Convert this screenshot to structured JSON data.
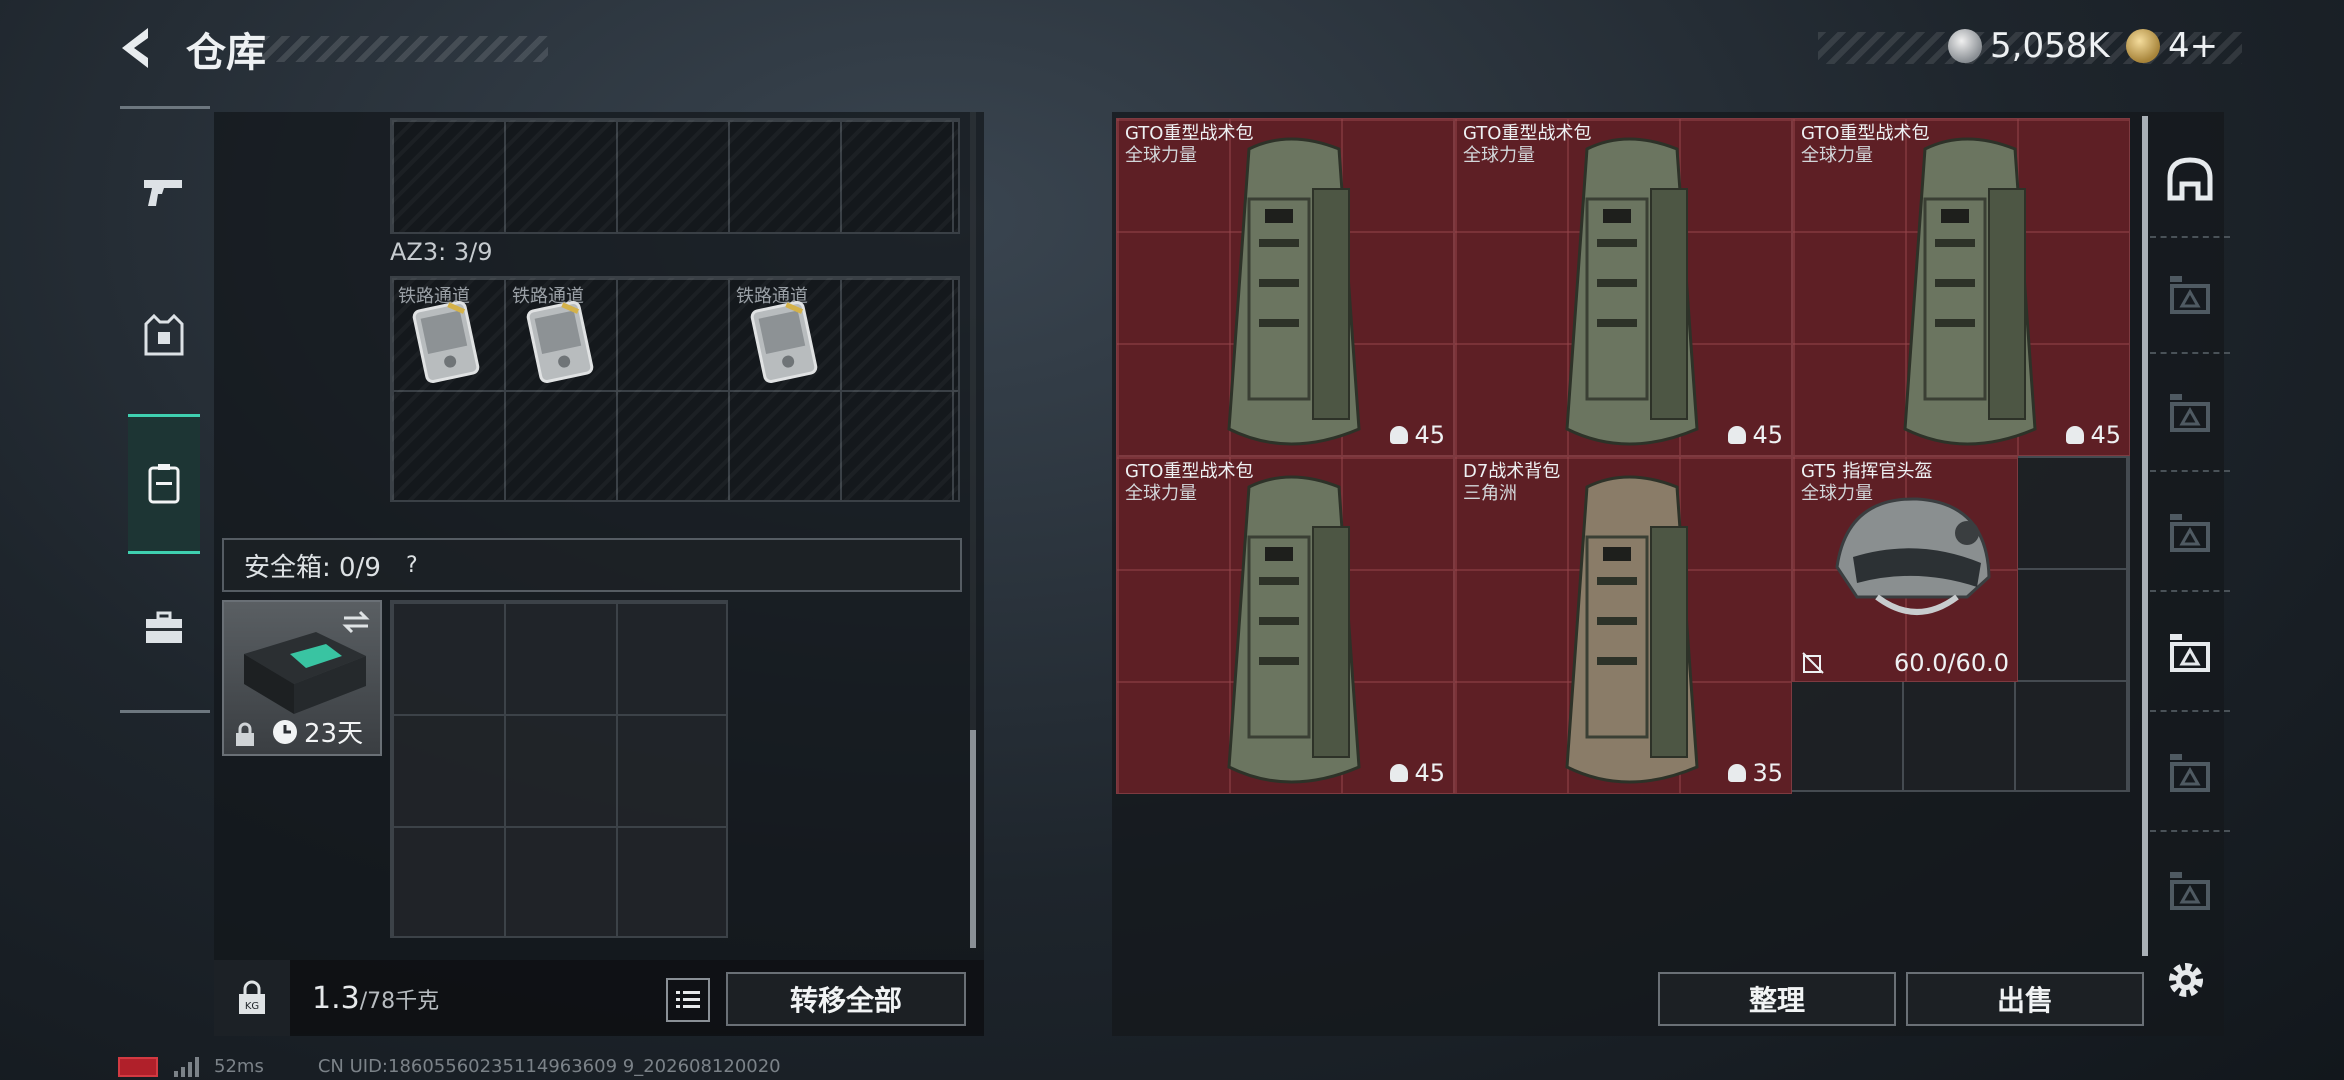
{
  "header": {
    "title": "仓库",
    "silver_amount": "5,058K",
    "gold_amount": "4+"
  },
  "left_rail": [
    "weapon-icon",
    "body-armor-icon",
    "backpack-icon",
    "briefcase-icon"
  ],
  "inventory": {
    "container_label": "AZ3: 3/9",
    "slot_items": [
      {
        "label": "铁路通道"
      },
      {
        "label": "铁路通道"
      },
      {
        "label": "铁路通道"
      }
    ],
    "safebox_label": "安全箱: 0/9",
    "help_icon": "?",
    "safebox_days": "23天"
  },
  "bottom_bar": {
    "weight_value": "1.3",
    "weight_capacity": "/78千克",
    "transfer_all": "转移全部"
  },
  "items": [
    {
      "name": "GTO重型战术包",
      "source": "全球力量",
      "capacity": "45",
      "color": "#6b7560"
    },
    {
      "name": "GTO重型战术包",
      "source": "全球力量",
      "capacity": "45",
      "color": "#6b7560"
    },
    {
      "name": "GTO重型战术包",
      "source": "全球力量",
      "capacity": "45",
      "color": "#6b7560"
    },
    {
      "name": "GTO重型战术包",
      "source": "全球力量",
      "capacity": "45",
      "color": "#6b7560"
    },
    {
      "name": "D7战术背包",
      "source": "三角洲",
      "capacity": "35",
      "color": "#8a7c68"
    },
    {
      "name": "GT5 指挥官头盔",
      "source": "全球力量",
      "durability": "60.0/60.0",
      "color": "#8a8f90"
    }
  ],
  "right_buttons": {
    "sort": "整理",
    "sell": "出售"
  },
  "right_rail": [
    "helmet-icon",
    "armor-iv-icon",
    "armor-iv-icon",
    "armor-iii-icon",
    "armor-ii-icon",
    "vest-iii-icon",
    "rig-iv-icon"
  ],
  "status": {
    "ping": "52ms",
    "uid": "CN UID:18605560235114963609 9_202608120020"
  },
  "colors": {
    "accent": "#3fd0b0",
    "item_bg": "#5e1f25"
  }
}
